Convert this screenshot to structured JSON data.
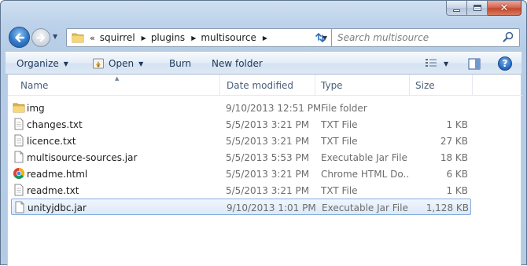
{
  "window": {
    "controls": {
      "minimize_icon": "minimize-icon",
      "maximize_icon": "maximize-icon",
      "close_icon": "close-icon"
    }
  },
  "nav": {
    "breadcrumb_overflow": "«",
    "breadcrumbs": [
      "squirrel",
      "plugins",
      "multisource"
    ],
    "search_placeholder": "Search multisource"
  },
  "toolbar": {
    "organize": "Organize",
    "open": "Open",
    "burn": "Burn",
    "new_folder": "New folder"
  },
  "columns": {
    "name": "Name",
    "date": "Date modified",
    "type": "Type",
    "size": "Size"
  },
  "files": [
    {
      "name": "img",
      "date": "9/10/2013 12:51 PM",
      "type": "File folder",
      "size": "",
      "icon": "folder-icon"
    },
    {
      "name": "changes.txt",
      "date": "5/5/2013 3:21 PM",
      "type": "TXT File",
      "size": "1 KB",
      "icon": "text-file-icon"
    },
    {
      "name": "licence.txt",
      "date": "5/5/2013 3:21 PM",
      "type": "TXT File",
      "size": "27 KB",
      "icon": "text-file-icon"
    },
    {
      "name": "multisource-sources.jar",
      "date": "5/5/2013 5:53 PM",
      "type": "Executable Jar File",
      "size": "18 KB",
      "icon": "jar-file-icon"
    },
    {
      "name": "readme.html",
      "date": "5/5/2013 3:21 PM",
      "type": "Chrome HTML Do...",
      "size": "6 KB",
      "icon": "chrome-icon"
    },
    {
      "name": "readme.txt",
      "date": "5/5/2013 3:21 PM",
      "type": "TXT File",
      "size": "1 KB",
      "icon": "text-file-icon"
    },
    {
      "name": "unityjdbc.jar",
      "date": "9/10/2013 1:01 PM",
      "type": "Executable Jar File",
      "size": "1,128 KB",
      "icon": "jar-file-icon",
      "selected": true
    }
  ],
  "colors": {
    "accent": "#2f78c8",
    "selection_border": "#84acdd",
    "frame": "#b9cfe7"
  }
}
